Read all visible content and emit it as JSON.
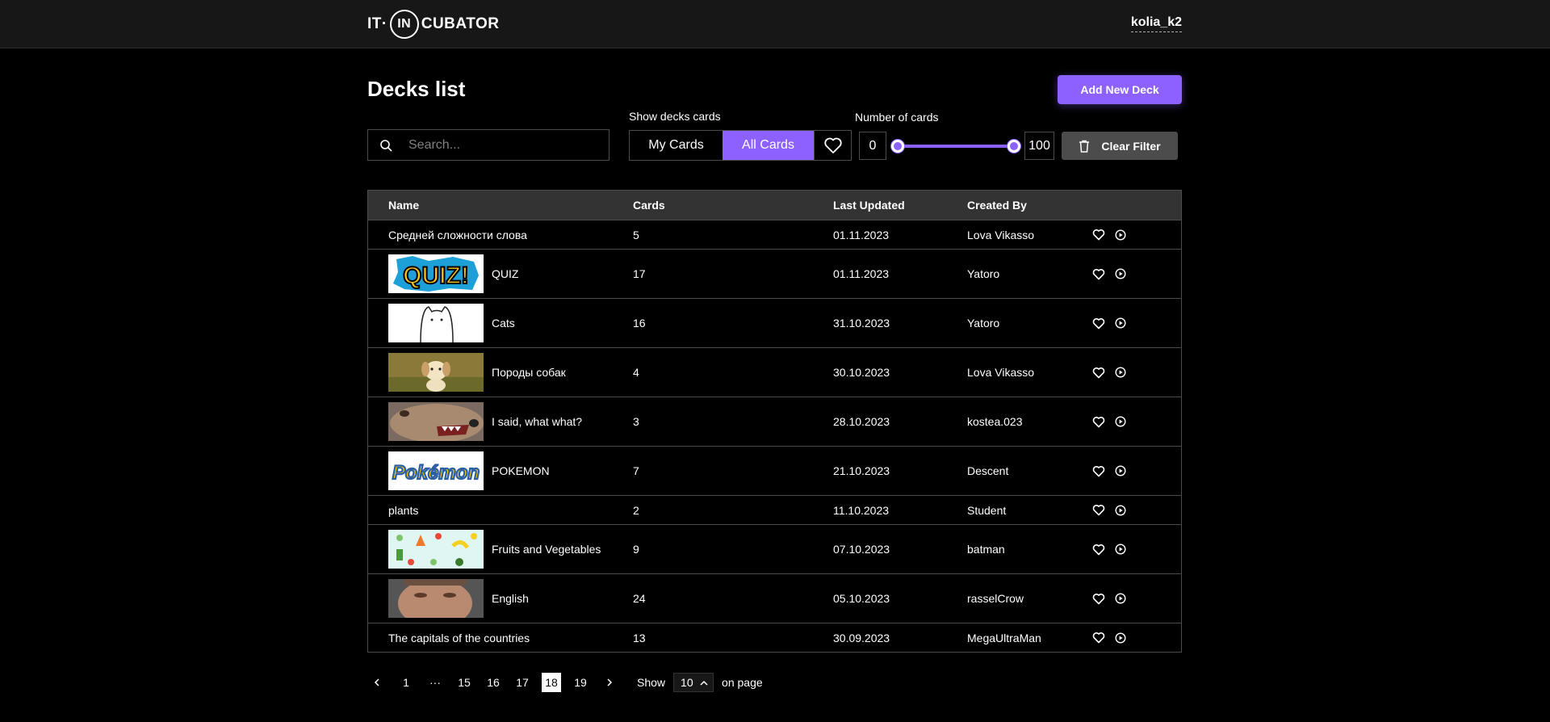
{
  "header": {
    "logo_left": "IT·",
    "logo_circle": "IN",
    "logo_right": "CUBATOR",
    "user_name": "kolia_k2"
  },
  "page": {
    "title": "Decks list",
    "add_button": "Add New Deck"
  },
  "filters": {
    "search_placeholder": "Search...",
    "show_label": "Show decks cards",
    "my_cards": "My Cards",
    "all_cards": "All Cards",
    "active_tab": "All Cards",
    "number_label": "Number of cards",
    "min": "0",
    "max": "100",
    "clear_button": "Clear Filter"
  },
  "table": {
    "columns": [
      "Name",
      "Cards",
      "Last Updated",
      "Created By"
    ],
    "rows": [
      {
        "name": "Средней сложности слова",
        "cards": "5",
        "updated": "01.11.2023",
        "by": "Lova Vikasso",
        "thumb": ""
      },
      {
        "name": "QUIZ",
        "cards": "17",
        "updated": "01.11.2023",
        "by": "Yatoro",
        "thumb": "quiz"
      },
      {
        "name": "Cats",
        "cards": "16",
        "updated": "31.10.2023",
        "by": "Yatoro",
        "thumb": "cat"
      },
      {
        "name": "Породы собак",
        "cards": "4",
        "updated": "30.10.2023",
        "by": "Lova Vikasso",
        "thumb": "puppy"
      },
      {
        "name": "I said, what what?",
        "cards": "3",
        "updated": "28.10.2023",
        "by": "kostea.023",
        "thumb": "dog"
      },
      {
        "name": "POKEMON",
        "cards": "7",
        "updated": "21.10.2023",
        "by": "Descent",
        "thumb": "pokemon"
      },
      {
        "name": "plants",
        "cards": "2",
        "updated": "11.10.2023",
        "by": "Student",
        "thumb": ""
      },
      {
        "name": "Fruits and Vegetables",
        "cards": "9",
        "updated": "07.10.2023",
        "by": "batman",
        "thumb": "fruits"
      },
      {
        "name": "English",
        "cards": "24",
        "updated": "05.10.2023",
        "by": "rasselCrow",
        "thumb": "face"
      },
      {
        "name": "The capitals of the countries",
        "cards": "13",
        "updated": "30.09.2023",
        "by": "MegaUltraMan",
        "thumb": ""
      }
    ]
  },
  "pagination": {
    "pages": [
      "1",
      "···",
      "15",
      "16",
      "17",
      "18",
      "19"
    ],
    "current": "18",
    "show_label": "Show",
    "per_page": "10",
    "on_page_label": "on page"
  },
  "colors": {
    "accent": "#8c61ff",
    "background": "#000000",
    "header": "#171717",
    "table_head": "#333333",
    "border": "#4c4c4c"
  }
}
